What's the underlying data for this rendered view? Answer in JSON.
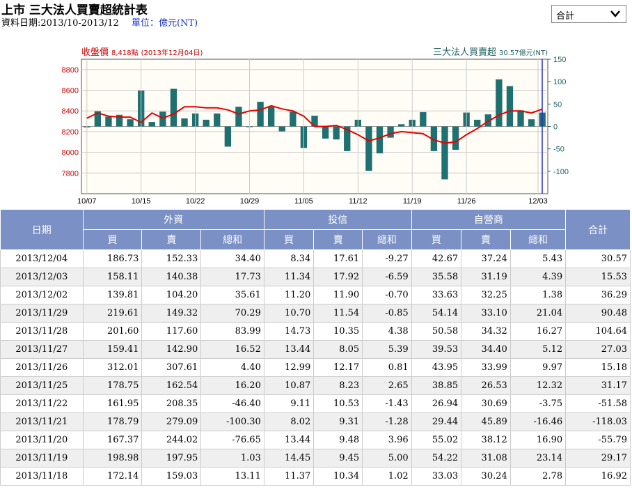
{
  "header": {
    "title": "上市 三大法人買賣超統計表",
    "date_range": "資料日期:2013/10-2013/12",
    "unit": "單位：億元(NT)"
  },
  "filter": {
    "selected": "合計",
    "icon": "chevron-down-icon"
  },
  "colors": {
    "price_line": "#e60000",
    "bar": "#1f7070",
    "accent": "#1a33cc",
    "header_bg": "#7b90c4"
  },
  "chart_data": {
    "type": "bar",
    "left_label": "收盤價",
    "left_value": "8,418點",
    "left_date": "(2013年12月04日)",
    "right_label": "三大法人買賣超",
    "right_value": "30.57億元(NT)",
    "x_ticks": [
      "10/07",
      "10/15",
      "10/22",
      "10/29",
      "11/05",
      "11/12",
      "11/19",
      "11/26",
      "12/03"
    ],
    "y_left_ticks": [
      "8800",
      "8600",
      "8400",
      "8200",
      "8000",
      "7800"
    ],
    "y_left_range": [
      7600,
      8900
    ],
    "y_right_ticks": [
      "150",
      "100",
      "50",
      "0",
      "-50",
      "-100"
    ],
    "y_right_range": [
      -150,
      150
    ],
    "bars": [
      -2,
      34,
      22,
      26,
      16,
      80,
      10,
      33,
      84,
      18,
      29,
      15,
      29,
      -45,
      44,
      0,
      55,
      44,
      -11,
      33,
      -48,
      24,
      -27,
      -29,
      -55,
      15,
      -99,
      -60,
      -25,
      5,
      15,
      32,
      -55,
      -118,
      -52,
      31,
      15,
      27,
      105,
      90,
      36,
      16,
      31
    ],
    "price": [
      8330,
      8380,
      8350,
      8340,
      8340,
      8290,
      8380,
      8330,
      8370,
      8440,
      8440,
      8430,
      8430,
      8410,
      8370,
      8400,
      8410,
      8450,
      8420,
      8400,
      8350,
      8250,
      8250,
      8260,
      8220,
      8170,
      8110,
      8140,
      8180,
      8200,
      8190,
      8180,
      8120,
      8090,
      8100,
      8170,
      8230,
      8300,
      8360,
      8400,
      8400,
      8380,
      8418
    ]
  },
  "table": {
    "headers": {
      "date": "日期",
      "foreign": "外資",
      "trust": "投信",
      "dealer": "自營商",
      "total": "合計",
      "buy": "買",
      "sell": "賣",
      "net": "總和"
    },
    "rows": [
      [
        "2013/12/04",
        "186.73",
        "152.33",
        "34.40",
        "8.34",
        "17.61",
        "-9.27",
        "42.67",
        "37.24",
        "5.43",
        "30.57"
      ],
      [
        "2013/12/03",
        "158.11",
        "140.38",
        "17.73",
        "11.34",
        "17.92",
        "-6.59",
        "35.58",
        "31.19",
        "4.39",
        "15.53"
      ],
      [
        "2013/12/02",
        "139.81",
        "104.20",
        "35.61",
        "11.20",
        "11.90",
        "-0.70",
        "33.63",
        "32.25",
        "1.38",
        "36.29"
      ],
      [
        "2013/11/29",
        "219.61",
        "149.32",
        "70.29",
        "10.70",
        "11.54",
        "-0.85",
        "54.14",
        "33.10",
        "21.04",
        "90.48"
      ],
      [
        "2013/11/28",
        "201.60",
        "117.60",
        "83.99",
        "14.73",
        "10.35",
        "4.38",
        "50.58",
        "34.32",
        "16.27",
        "104.64"
      ],
      [
        "2013/11/27",
        "159.41",
        "142.90",
        "16.52",
        "13.44",
        "8.05",
        "5.39",
        "39.53",
        "34.40",
        "5.12",
        "27.03"
      ],
      [
        "2013/11/26",
        "312.01",
        "307.61",
        "4.40",
        "12.99",
        "12.17",
        "0.81",
        "43.95",
        "33.99",
        "9.97",
        "15.18"
      ],
      [
        "2013/11/25",
        "178.75",
        "162.54",
        "16.20",
        "10.87",
        "8.23",
        "2.65",
        "38.85",
        "26.53",
        "12.32",
        "31.17"
      ],
      [
        "2013/11/22",
        "161.95",
        "208.35",
        "-46.40",
        "9.11",
        "10.53",
        "-1.43",
        "26.94",
        "30.69",
        "-3.75",
        "-51.58"
      ],
      [
        "2013/11/21",
        "178.79",
        "279.09",
        "-100.30",
        "8.02",
        "9.31",
        "-1.28",
        "29.44",
        "45.89",
        "-16.46",
        "-118.03"
      ],
      [
        "2013/11/20",
        "167.37",
        "244.02",
        "-76.65",
        "13.44",
        "9.48",
        "3.96",
        "55.02",
        "38.12",
        "16.90",
        "-55.79"
      ],
      [
        "2013/11/19",
        "198.98",
        "197.95",
        "1.03",
        "14.45",
        "9.45",
        "5.00",
        "54.22",
        "31.08",
        "23.14",
        "29.17"
      ],
      [
        "2013/11/18",
        "172.14",
        "159.03",
        "13.11",
        "11.37",
        "10.34",
        "1.02",
        "33.03",
        "30.24",
        "2.78",
        "16.92"
      ]
    ]
  }
}
